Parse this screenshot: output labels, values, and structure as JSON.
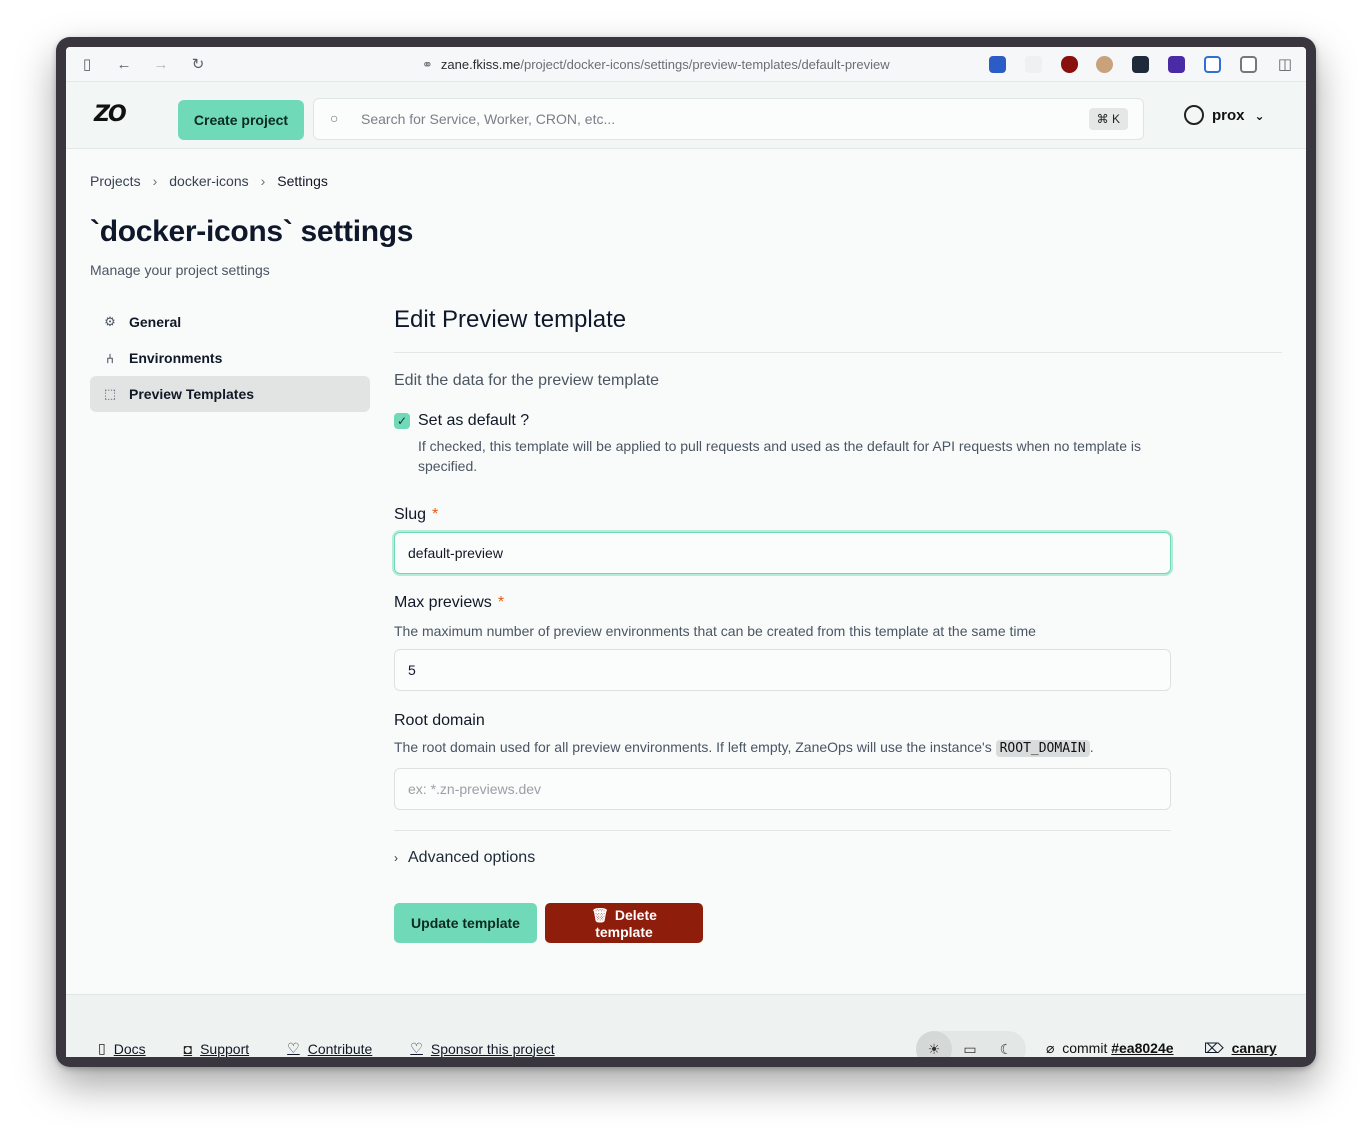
{
  "browser": {
    "url_domain": "zane.fkiss.me",
    "url_path": "/project/docker-icons/settings/preview-templates/default-preview"
  },
  "header": {
    "logo": "ZO",
    "create_project": "Create project",
    "search_placeholder": "Search for Service, Worker, CRON, etc...",
    "shortcut": "⌘ K",
    "user": "prox"
  },
  "breadcrumb": {
    "items": [
      "Projects",
      "docker-icons",
      "Settings"
    ]
  },
  "page": {
    "title": "`docker-icons` settings",
    "subtitle": "Manage your project settings"
  },
  "sidebar": {
    "items": [
      {
        "label": "General",
        "icon": "gear-icon"
      },
      {
        "label": "Environments",
        "icon": "network-icon"
      },
      {
        "label": "Preview Templates",
        "icon": "template-icon",
        "active": true
      }
    ]
  },
  "form": {
    "heading": "Edit Preview template",
    "description": "Edit the data for the preview template",
    "default_label": "Set as default ?",
    "default_checked": true,
    "default_help": "If checked, this template will be applied to pull requests and used as the default for API requests when no template is specified.",
    "slug_label": "Slug",
    "slug_value": "default-preview",
    "max_label": "Max previews",
    "max_help": "The maximum number of preview environments that can be created from this template at the same time",
    "max_value": "5",
    "root_label": "Root domain",
    "root_help_prefix": "The root domain used for all preview environments. If left empty, ZaneOps will use the instance's",
    "root_help_code": "ROOT_DOMAIN",
    "root_help_suffix": ".",
    "root_placeholder": "ex: *.zn-previews.dev",
    "advanced": "Advanced options",
    "update_button": "Update template",
    "delete_button": "Delete template"
  },
  "footer": {
    "docs": "Docs",
    "support": "Support",
    "contribute": "Contribute",
    "sponsor": "Sponsor this project",
    "commit_label": "commit",
    "commit_hash": "#ea8024e",
    "channel": "canary"
  },
  "colors": {
    "accent": "#6fd9b8",
    "danger": "#8f1d0b",
    "required": "#ea580c"
  }
}
